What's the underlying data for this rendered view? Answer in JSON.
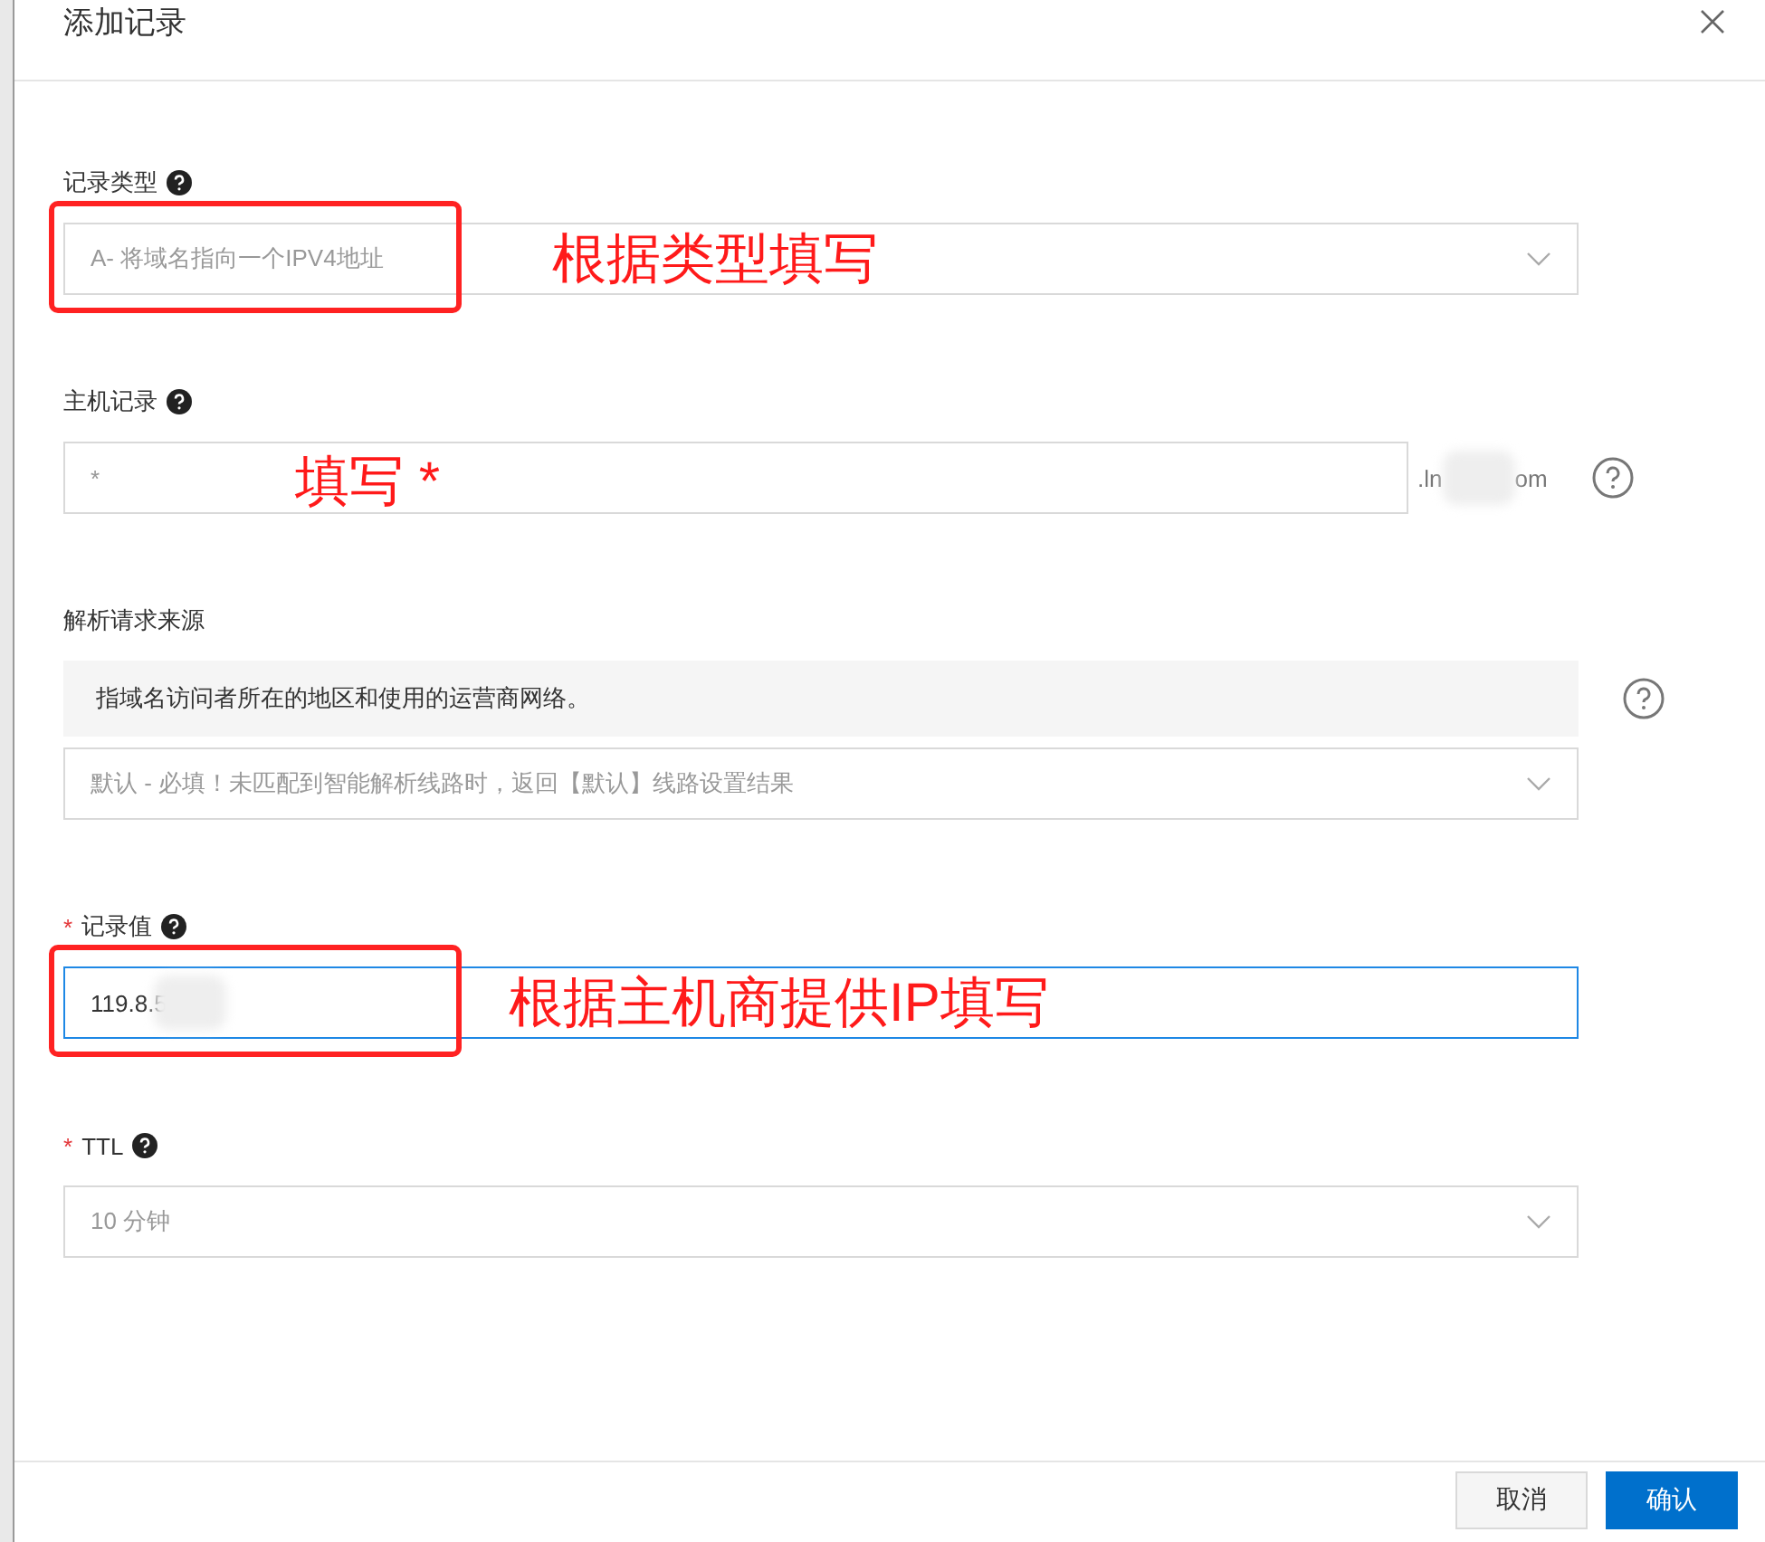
{
  "dialog": {
    "title": "添加记录"
  },
  "fields": [
    {
      "kind": "select",
      "label": "记录类型",
      "required": false,
      "help": true,
      "value": "A- 将域名指向一个IPV4地址",
      "annotation": {
        "text": "根据类型填写",
        "boxed": true
      }
    },
    {
      "kind": "input",
      "label": "主机记录",
      "required": false,
      "help": true,
      "placeholder": "*",
      "suffix_start": ".ln",
      "suffix_end": "om",
      "side_help": true,
      "annotation": {
        "text": "填写 *",
        "boxed": false
      }
    },
    {
      "kind": "source",
      "label": "解析请求来源",
      "required": false,
      "help": false,
      "description": "指域名访问者所在的地区和使用的运营商网络。",
      "value": "默认 - 必填！未匹配到智能解析线路时，返回【默认】线路设置结果",
      "side_help": true
    },
    {
      "kind": "input",
      "label": "记录值",
      "required": true,
      "help": true,
      "value": "119.8.5",
      "focused": true,
      "annotation": {
        "text": "根据主机商提供IP填写",
        "boxed": true
      }
    },
    {
      "kind": "select",
      "label": "TTL",
      "required": true,
      "help": true,
      "value": "10 分钟"
    }
  ],
  "buttons": [
    {
      "label": "取消",
      "primary": false
    },
    {
      "label": "确认",
      "primary": true
    }
  ]
}
